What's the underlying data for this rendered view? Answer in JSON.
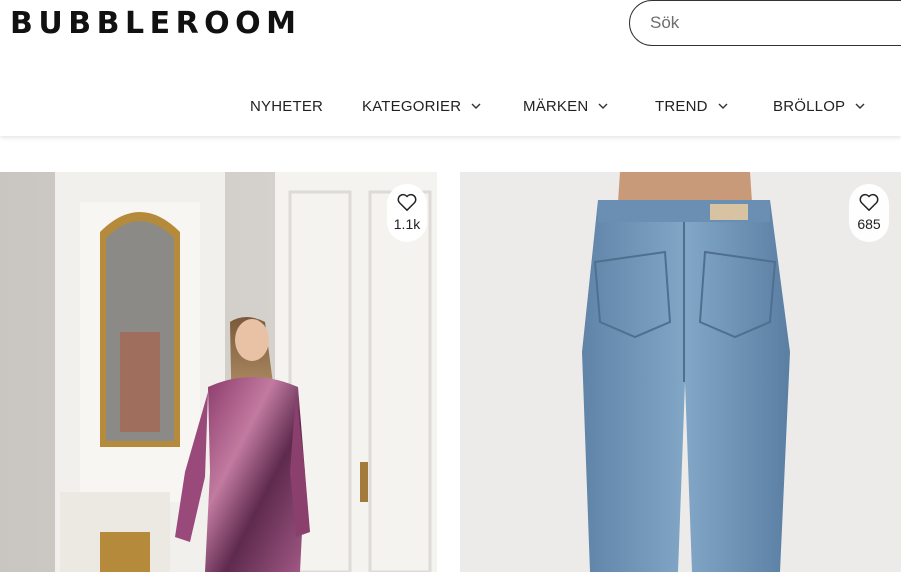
{
  "brand": {
    "logo_text": "BUBBLEROOM"
  },
  "search": {
    "placeholder": "Sök",
    "value": ""
  },
  "nav": {
    "items": [
      {
        "label": "NYHETER",
        "has_dropdown": false
      },
      {
        "label": "KATEGORIER",
        "has_dropdown": true
      },
      {
        "label": "MÄRKEN",
        "has_dropdown": true
      },
      {
        "label": "TREND",
        "has_dropdown": true
      },
      {
        "label": "BRÖLLOP",
        "has_dropdown": true
      }
    ]
  },
  "products": [
    {
      "image": "woman-in-purple-mesh-dress-photo",
      "favorites_count": "1.1k",
      "icon": "heart-icon"
    },
    {
      "image": "blue-jeans-back-view-photo",
      "favorites_count": "685",
      "icon": "heart-icon"
    }
  ],
  "colors": {
    "text": "#111111",
    "border": "#333333",
    "background": "#ffffff"
  }
}
